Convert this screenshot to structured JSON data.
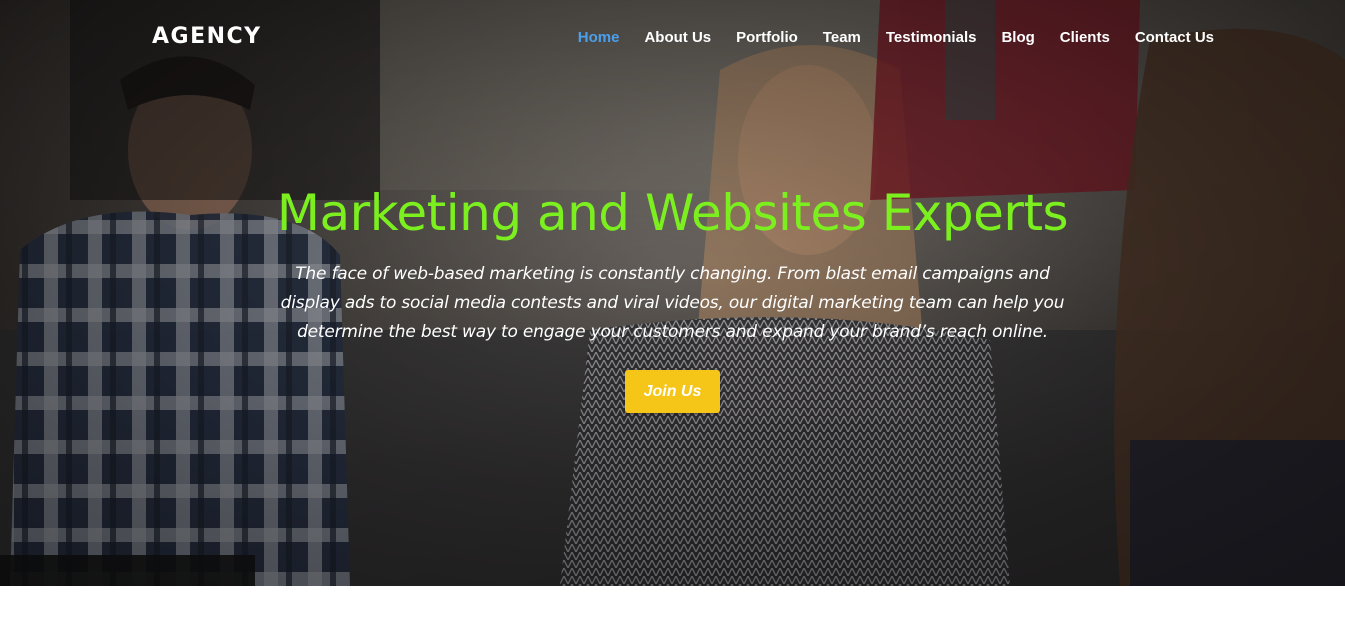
{
  "brand": {
    "logo_text": "AGENCY"
  },
  "nav": {
    "items": [
      {
        "label": "Home",
        "active": true
      },
      {
        "label": "About Us",
        "active": false
      },
      {
        "label": "Portfolio",
        "active": false
      },
      {
        "label": "Team",
        "active": false
      },
      {
        "label": "Testimonials",
        "active": false
      },
      {
        "label": "Blog",
        "active": false
      },
      {
        "label": "Clients",
        "active": false
      },
      {
        "label": "Contact Us",
        "active": false
      }
    ]
  },
  "hero": {
    "title": "Marketing and Websites Experts",
    "description": "The face of web-based marketing is constantly changing. From blast email campaigns and display ads to social media contests and viral videos, our digital marketing team can help you determine the best way to engage your customers and expand your brand’s reach online.",
    "cta_label": "Join Us"
  },
  "colors": {
    "title_green": "#7cf01f",
    "nav_active_blue": "#4aa0ee",
    "cta_yellow": "#f5c518",
    "white": "#ffffff"
  }
}
